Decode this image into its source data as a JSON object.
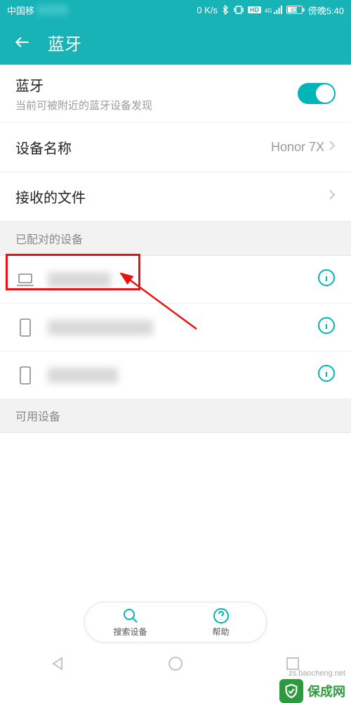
{
  "status": {
    "carrier": "中国移",
    "net_speed": "0 K/s",
    "hd_badge": "HD",
    "net_gen": "4G",
    "battery_pct": "63",
    "time": "傍晚5:40"
  },
  "header": {
    "title": "蓝牙"
  },
  "bluetooth": {
    "label": "蓝牙",
    "sub": "当前可被附近的蓝牙设备发现",
    "on": true
  },
  "device_name": {
    "label": "设备名称",
    "value": "Honor 7X"
  },
  "received": {
    "label": "接收的文件"
  },
  "paired": {
    "section_label": "已配对的设备",
    "devices": [
      {
        "icon": "laptop",
        "blur_w": 90
      },
      {
        "icon": "phone",
        "blur_w": 150
      },
      {
        "icon": "phone",
        "blur_w": 100
      }
    ]
  },
  "available": {
    "section_label": "可用设备"
  },
  "actions": {
    "search": "搜索设备",
    "help": "帮助"
  },
  "watermark": {
    "brand": "保成网",
    "url": "zs.baocheng.net"
  }
}
